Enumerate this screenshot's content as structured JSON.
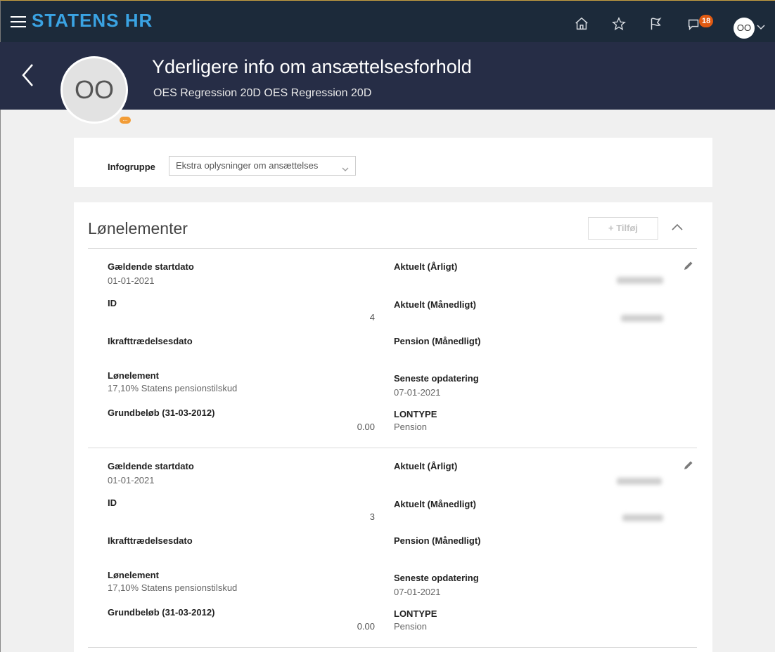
{
  "topbar": {
    "brand": "STATENS HR",
    "notifications_count": "18",
    "user_initials": "OO",
    "icons": [
      "menu-icon",
      "home-icon",
      "star-icon",
      "flag-icon",
      "notifications-icon",
      "chevron-down-icon"
    ]
  },
  "header": {
    "title": "Yderligere info om ansættelsesforhold",
    "subtitle": "OES Regression 20D OES Regression 20D",
    "avatar_initials": "OO",
    "avatar_badge": "..."
  },
  "infogruppe": {
    "label": "Infogruppe",
    "selected": "Ekstra oplysninger om ansættelses"
  },
  "section": {
    "title": "Lønelementer",
    "add_label": "+ Tilføj"
  },
  "records": [
    {
      "startdato_label": "Gældende startdato",
      "startdato": "01-01-2021",
      "id_label": "ID",
      "id": "4",
      "ikraft_label": "Ikrafttrædelsesdato",
      "lonelement_label": "Lønelement",
      "lonelement": "17,10% Statens pensionstilskud",
      "grundbelob_label": "Grundbeløb (31-03-2012)",
      "grundbelob": "0.00",
      "aktuelt_aarligt_label": "Aktuelt (Årligt)",
      "aktuelt_maanedligt_label": "Aktuelt (Månedligt)",
      "pension_label": "Pension (Månedligt)",
      "seneste_label": "Seneste opdatering",
      "seneste": "07-01-2021",
      "lontype_label": "LONTYPE",
      "lontype": "Pension"
    },
    {
      "startdato_label": "Gældende startdato",
      "startdato": "01-01-2021",
      "id_label": "ID",
      "id": "3",
      "ikraft_label": "Ikrafttrædelsesdato",
      "lonelement_label": "Lønelement",
      "lonelement": "17,10% Statens pensionstilskud",
      "grundbelob_label": "Grundbeløb (31-03-2012)",
      "grundbelob": "0.00",
      "aktuelt_aarligt_label": "Aktuelt (Årligt)",
      "aktuelt_maanedligt_label": "Aktuelt (Månedligt)",
      "pension_label": "Pension (Månedligt)",
      "seneste_label": "Seneste opdatering",
      "seneste": "07-01-2021",
      "lontype_label": "LONTYPE",
      "lontype": "Pension"
    }
  ]
}
